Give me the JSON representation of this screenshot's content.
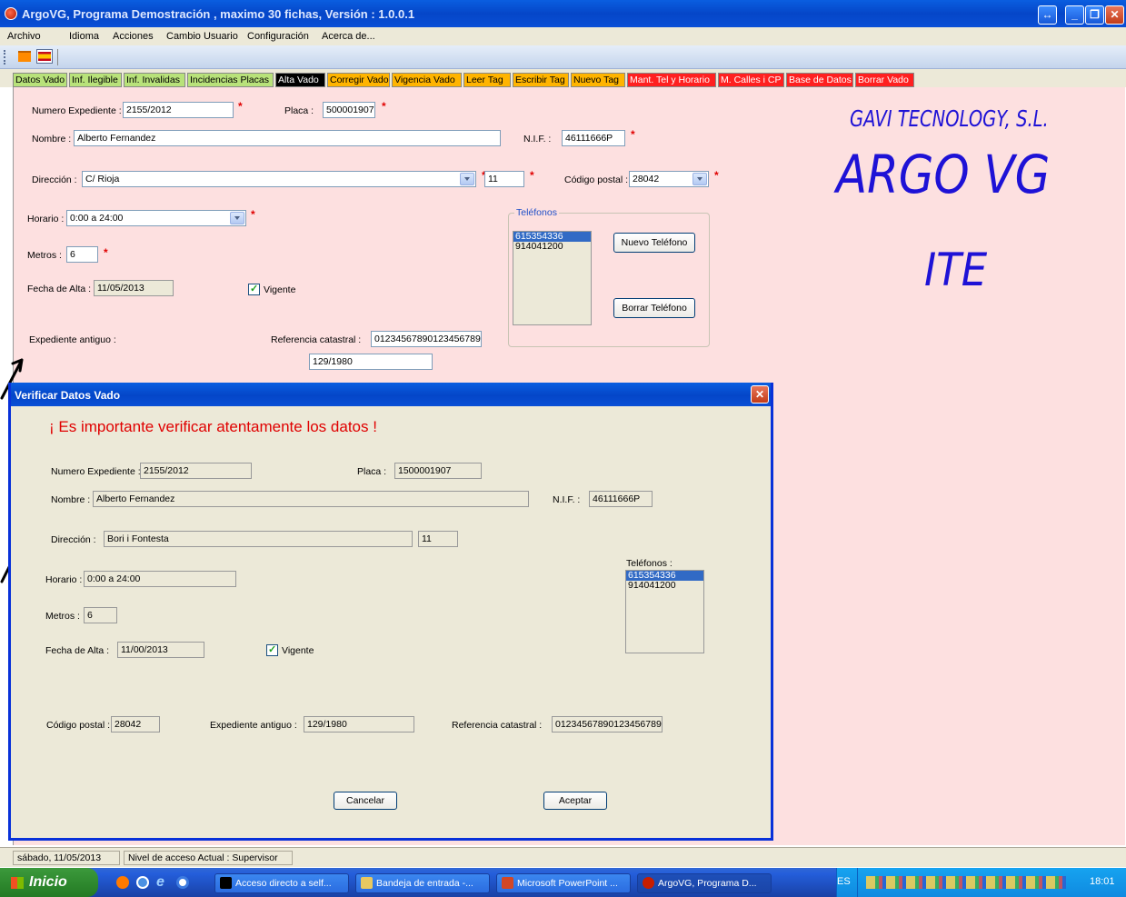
{
  "window": {
    "title": "ArgoVG, Programa Demostración , maximo 30 fichas, Versión : 1.0.0.1"
  },
  "menu": [
    "Archivo",
    "Idioma",
    "Acciones",
    "Cambio Usuario",
    "Configuración",
    "Acerca de..."
  ],
  "tabs": [
    {
      "label": "Datos Vado",
      "color": "#b8e27a"
    },
    {
      "label": "Inf. Ilegible",
      "color": "#b8e27a"
    },
    {
      "label": "Inf. Invalidas",
      "color": "#b8e27a"
    },
    {
      "label": "Incidencias Placas",
      "color": "#b8e27a"
    },
    {
      "label": "Alta Vado",
      "color": "#000000"
    },
    {
      "label": "Corregir Vado",
      "color": "#ffb400"
    },
    {
      "label": "Vigencia Vado",
      "color": "#ffb400"
    },
    {
      "label": "Leer Tag",
      "color": "#ffb400"
    },
    {
      "label": "Escribir Tag",
      "color": "#ffb400"
    },
    {
      "label": "Nuevo Tag",
      "color": "#ffb400"
    },
    {
      "label": "Mant. Tel y Horario",
      "color": "#ff2020"
    },
    {
      "label": "M. Calles i CP",
      "color": "#ff2020"
    },
    {
      "label": "Base de Datos",
      "color": "#ff2020"
    },
    {
      "label": "Borrar Vado",
      "color": "#ff2020"
    }
  ],
  "form": {
    "numero_expediente_label": "Numero Expediente :",
    "numero_expediente": "2155/2012",
    "placa_label": "Placa :",
    "placa": "500001907",
    "nombre_label": "Nombre :",
    "nombre": "Alberto Fernandez",
    "nif_label": "N.I.F. :",
    "nif": "46111666P",
    "direccion_label": "Dirección :",
    "direccion": "C/ Rioja",
    "numero": "11",
    "codigo_postal_label": "Código postal :",
    "codigo_postal": "28042",
    "horario_label": "Horario :",
    "horario": "0:00 a 24:00",
    "metros_label": "Metros :",
    "metros": "6",
    "fecha_alta_label": "Fecha de Alta :",
    "fecha_alta": "11/05/2013",
    "vigente_label": "Vigente",
    "vigente": true,
    "expediente_antiguo_label": "Expediente antiguo :",
    "expediente_antiguo": "129/1980",
    "referencia_catastral_label": "Referencia catastral :",
    "referencia_catastral": "01234567890123456789",
    "required_mark": "*",
    "telefonos_group_label": "Teléfonos",
    "telefonos": [
      "615354336",
      "914041200"
    ],
    "nuevo_telefono_button": "Nuevo Teléfono",
    "borrar_telefono_button": "Borrar Teléfono"
  },
  "logo": {
    "company": "GAVI TECNOLOGY, S.L.",
    "product": "ARGO VG",
    "suffix": "ITE",
    "color": "#1e12d6"
  },
  "dialog": {
    "title": "Verificar Datos Vado",
    "warning": "¡ Es importante verificar atentamente los datos !",
    "numero_expediente_label": "Numero Expediente :",
    "numero_expediente": "2155/2012",
    "placa_label": "Placa :",
    "placa": "1500001907",
    "nombre_label": "Nombre :",
    "nombre": "Alberto Fernandez",
    "nif_label": "N.I.F. :",
    "nif": "46111666P",
    "direccion_label": "Dirección :",
    "direccion": "Bori i Fontesta",
    "numero": "11",
    "telefonos_label": "Teléfonos :",
    "telefonos": [
      "615354336",
      "914041200"
    ],
    "horario_label": "Horario :",
    "horario": "0:00 a 24:00",
    "metros_label": "Metros :",
    "metros": "6",
    "fecha_alta_label": "Fecha de Alta :",
    "fecha_alta": "11/00/2013",
    "vigente_label": "Vigente",
    "codigo_postal_label": "Código postal :",
    "codigo_postal": "28042",
    "expediente_antiguo_label": "Expediente antiguo :",
    "expediente_antiguo": "129/1980",
    "referencia_catastral_label": "Referencia catastral :",
    "referencia_catastral": "01234567890123456789",
    "cancelar_button": "Cancelar",
    "aceptar_button": "Aceptar"
  },
  "status": {
    "date": "sábado, 11/05/2013",
    "access_level": "Nivel de acceso Actual : Supervisor"
  },
  "taskbar": {
    "start": "Inicio",
    "tasks": [
      "Acceso directo a self...",
      "Bandeja de entrada -...",
      "Microsoft PowerPoint ...",
      "ArgoVG, Programa D..."
    ],
    "language": "ES",
    "clock": "18:01"
  }
}
